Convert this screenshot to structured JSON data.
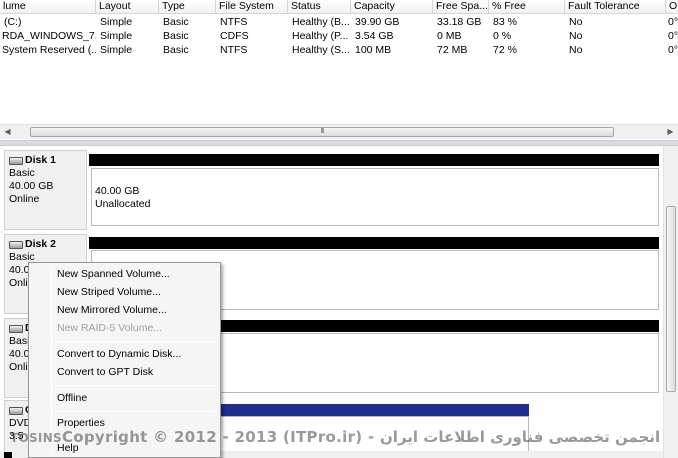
{
  "volume_list": {
    "columns": [
      "lume",
      "Layout",
      "Type",
      "File System",
      "Status",
      "Capacity",
      "Free Spa...",
      "% Free",
      "Fault Tolerance",
      "O"
    ],
    "rows": [
      [
        "(C:)",
        "Simple",
        "Basic",
        "NTFS",
        "Healthy (B...",
        "39.90 GB",
        "33.18 GB",
        "83 %",
        "No",
        "0°"
      ],
      [
        "RDA_WINDOWS_7...",
        "Simple",
        "Basic",
        "CDFS",
        "Healthy (P...",
        "3.54 GB",
        "0 MB",
        "0 %",
        "No",
        "0°"
      ],
      [
        "System Reserved (...",
        "Simple",
        "Basic",
        "NTFS",
        "Healthy (S...",
        "100 MB",
        "72 MB",
        "72 %",
        "No",
        "0°"
      ]
    ],
    "scroll_left_glyph": "◀",
    "scroll_right_glyph": "▶",
    "scroll_grip_glyph": "III"
  },
  "disks": [
    {
      "name": "Disk 1",
      "type": "Basic",
      "size": "40.00 GB",
      "status": "Online",
      "partition_size": "40.00 GB",
      "partition_state": "Unallocated"
    },
    {
      "name": "Disk 2",
      "type": "Basic",
      "size": "40.00",
      "status": "Onli"
    },
    {
      "name": "D",
      "type": "Basic",
      "size": "40.00",
      "status": "Onli"
    },
    {
      "name": "C",
      "type": "DVD",
      "size": "3.5"
    }
  ],
  "context_menu": {
    "items": [
      {
        "label": "New Spanned Volume...",
        "enabled": true
      },
      {
        "label": "New Striped Volume...",
        "enabled": true
      },
      {
        "label": "New Mirrored Volume...",
        "enabled": true
      },
      {
        "label": "New RAID-5 Volume...",
        "enabled": false
      },
      {
        "label": "Convert to Dynamic Disk...",
        "enabled": true
      },
      {
        "label": "Convert to GPT Disk",
        "enabled": true
      },
      {
        "label": "Offline",
        "enabled": true
      },
      {
        "label": "Properties",
        "enabled": true
      },
      {
        "label": "Help",
        "enabled": true
      }
    ]
  },
  "watermark": {
    "text": "Copyright © 2012 - 2013 (ITPro.ir) - انجمن تخصصی فناوری اطلاعات ایران",
    "prefix": "TOSINS"
  },
  "colors": {
    "partition_bar": "#000000",
    "dvd_bar": "#1e2f8c",
    "menu_background": "#f5f5f5",
    "disabled_text": "#a0a0a0"
  }
}
